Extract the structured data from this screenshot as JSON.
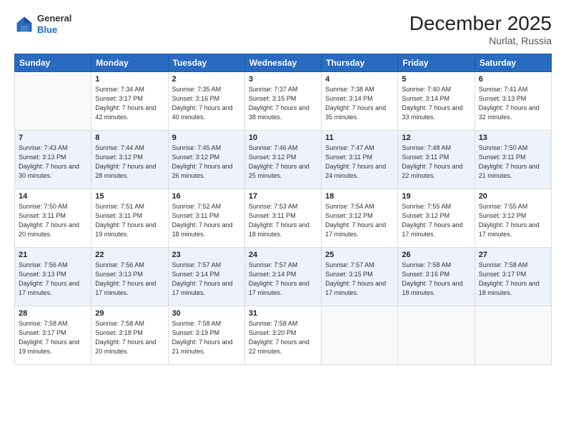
{
  "header": {
    "logo_general": "General",
    "logo_blue": "Blue",
    "month_title": "December 2025",
    "location": "Nurlat, Russia"
  },
  "columns": [
    "Sunday",
    "Monday",
    "Tuesday",
    "Wednesday",
    "Thursday",
    "Friday",
    "Saturday"
  ],
  "rows": [
    [
      {
        "day": "",
        "sunrise": "",
        "sunset": "",
        "daylight": ""
      },
      {
        "day": "1",
        "sunrise": "Sunrise: 7:34 AM",
        "sunset": "Sunset: 3:17 PM",
        "daylight": "Daylight: 7 hours and 42 minutes."
      },
      {
        "day": "2",
        "sunrise": "Sunrise: 7:35 AM",
        "sunset": "Sunset: 3:16 PM",
        "daylight": "Daylight: 7 hours and 40 minutes."
      },
      {
        "day": "3",
        "sunrise": "Sunrise: 7:37 AM",
        "sunset": "Sunset: 3:15 PM",
        "daylight": "Daylight: 7 hours and 38 minutes."
      },
      {
        "day": "4",
        "sunrise": "Sunrise: 7:38 AM",
        "sunset": "Sunset: 3:14 PM",
        "daylight": "Daylight: 7 hours and 35 minutes."
      },
      {
        "day": "5",
        "sunrise": "Sunrise: 7:40 AM",
        "sunset": "Sunset: 3:14 PM",
        "daylight": "Daylight: 7 hours and 33 minutes."
      },
      {
        "day": "6",
        "sunrise": "Sunrise: 7:41 AM",
        "sunset": "Sunset: 3:13 PM",
        "daylight": "Daylight: 7 hours and 32 minutes."
      }
    ],
    [
      {
        "day": "7",
        "sunrise": "Sunrise: 7:43 AM",
        "sunset": "Sunset: 3:13 PM",
        "daylight": "Daylight: 7 hours and 30 minutes."
      },
      {
        "day": "8",
        "sunrise": "Sunrise: 7:44 AM",
        "sunset": "Sunset: 3:12 PM",
        "daylight": "Daylight: 7 hours and 28 minutes."
      },
      {
        "day": "9",
        "sunrise": "Sunrise: 7:45 AM",
        "sunset": "Sunset: 3:12 PM",
        "daylight": "Daylight: 7 hours and 26 minutes."
      },
      {
        "day": "10",
        "sunrise": "Sunrise: 7:46 AM",
        "sunset": "Sunset: 3:12 PM",
        "daylight": "Daylight: 7 hours and 25 minutes."
      },
      {
        "day": "11",
        "sunrise": "Sunrise: 7:47 AM",
        "sunset": "Sunset: 3:11 PM",
        "daylight": "Daylight: 7 hours and 24 minutes."
      },
      {
        "day": "12",
        "sunrise": "Sunrise: 7:48 AM",
        "sunset": "Sunset: 3:11 PM",
        "daylight": "Daylight: 7 hours and 22 minutes."
      },
      {
        "day": "13",
        "sunrise": "Sunrise: 7:50 AM",
        "sunset": "Sunset: 3:11 PM",
        "daylight": "Daylight: 7 hours and 21 minutes."
      }
    ],
    [
      {
        "day": "14",
        "sunrise": "Sunrise: 7:50 AM",
        "sunset": "Sunset: 3:11 PM",
        "daylight": "Daylight: 7 hours and 20 minutes."
      },
      {
        "day": "15",
        "sunrise": "Sunrise: 7:51 AM",
        "sunset": "Sunset: 3:11 PM",
        "daylight": "Daylight: 7 hours and 19 minutes."
      },
      {
        "day": "16",
        "sunrise": "Sunrise: 7:52 AM",
        "sunset": "Sunset: 3:11 PM",
        "daylight": "Daylight: 7 hours and 18 minutes."
      },
      {
        "day": "17",
        "sunrise": "Sunrise: 7:53 AM",
        "sunset": "Sunset: 3:11 PM",
        "daylight": "Daylight: 7 hours and 18 minutes."
      },
      {
        "day": "18",
        "sunrise": "Sunrise: 7:54 AM",
        "sunset": "Sunset: 3:12 PM",
        "daylight": "Daylight: 7 hours and 17 minutes."
      },
      {
        "day": "19",
        "sunrise": "Sunrise: 7:55 AM",
        "sunset": "Sunset: 3:12 PM",
        "daylight": "Daylight: 7 hours and 17 minutes."
      },
      {
        "day": "20",
        "sunrise": "Sunrise: 7:55 AM",
        "sunset": "Sunset: 3:12 PM",
        "daylight": "Daylight: 7 hours and 17 minutes."
      }
    ],
    [
      {
        "day": "21",
        "sunrise": "Sunrise: 7:56 AM",
        "sunset": "Sunset: 3:13 PM",
        "daylight": "Daylight: 7 hours and 17 minutes."
      },
      {
        "day": "22",
        "sunrise": "Sunrise: 7:56 AM",
        "sunset": "Sunset: 3:13 PM",
        "daylight": "Daylight: 7 hours and 17 minutes."
      },
      {
        "day": "23",
        "sunrise": "Sunrise: 7:57 AM",
        "sunset": "Sunset: 3:14 PM",
        "daylight": "Daylight: 7 hours and 17 minutes."
      },
      {
        "day": "24",
        "sunrise": "Sunrise: 7:57 AM",
        "sunset": "Sunset: 3:14 PM",
        "daylight": "Daylight: 7 hours and 17 minutes."
      },
      {
        "day": "25",
        "sunrise": "Sunrise: 7:57 AM",
        "sunset": "Sunset: 3:15 PM",
        "daylight": "Daylight: 7 hours and 17 minutes."
      },
      {
        "day": "26",
        "sunrise": "Sunrise: 7:58 AM",
        "sunset": "Sunset: 3:16 PM",
        "daylight": "Daylight: 7 hours and 18 minutes."
      },
      {
        "day": "27",
        "sunrise": "Sunrise: 7:58 AM",
        "sunset": "Sunset: 3:17 PM",
        "daylight": "Daylight: 7 hours and 18 minutes."
      }
    ],
    [
      {
        "day": "28",
        "sunrise": "Sunrise: 7:58 AM",
        "sunset": "Sunset: 3:17 PM",
        "daylight": "Daylight: 7 hours and 19 minutes."
      },
      {
        "day": "29",
        "sunrise": "Sunrise: 7:58 AM",
        "sunset": "Sunset: 3:18 PM",
        "daylight": "Daylight: 7 hours and 20 minutes."
      },
      {
        "day": "30",
        "sunrise": "Sunrise: 7:58 AM",
        "sunset": "Sunset: 3:19 PM",
        "daylight": "Daylight: 7 hours and 21 minutes."
      },
      {
        "day": "31",
        "sunrise": "Sunrise: 7:58 AM",
        "sunset": "Sunset: 3:20 PM",
        "daylight": "Daylight: 7 hours and 22 minutes."
      },
      {
        "day": "",
        "sunrise": "",
        "sunset": "",
        "daylight": ""
      },
      {
        "day": "",
        "sunrise": "",
        "sunset": "",
        "daylight": ""
      },
      {
        "day": "",
        "sunrise": "",
        "sunset": "",
        "daylight": ""
      }
    ]
  ]
}
